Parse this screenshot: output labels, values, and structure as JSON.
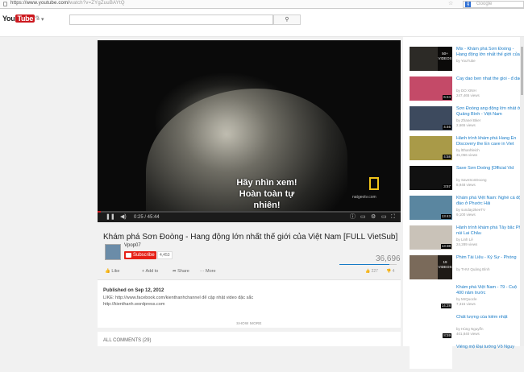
{
  "browser": {
    "url_prefix": "https://www.youtube.com/",
    "url_rest": "watch?v=ZYgZuuBAYtQ",
    "search_placeholder": "Google",
    "search_engine_icon": "g-icon"
  },
  "masthead": {
    "logo_you": "You",
    "logo_tube": "Tube",
    "logo_region": "VN",
    "guide_icon": "menu-icon",
    "search_icon": "magnifier-icon"
  },
  "player": {
    "subtitle_line1": "Hãy nhìn xem!",
    "subtitle_line2": "Hoàn toàn tự nhiên!",
    "watermark": "natgeotv.com",
    "time": "0:25 / 45:44",
    "progress_fraction": 0.01
  },
  "video": {
    "title": "Khám phá Sơn Đoòng - Hang động lớn nhất thế giới của Việt Nam [FULL VietSub]",
    "channel": "Vpop07",
    "subscribe_label": "Subscribe",
    "subscriber_count": "4,453",
    "views": "36,696",
    "like_fraction": 0.87,
    "actions": {
      "like": "Like",
      "add": "Add to",
      "share": "Share",
      "more": "More"
    },
    "likes": "227",
    "dislikes": "4"
  },
  "description": {
    "published": "Published on Sep 12, 2012",
    "line1": "LIKE: http://www.facebook.com/kienthanhchannel để cập nhật video đặc sắc",
    "line2": "http://kienthanh.wordpress.com",
    "show_more": "SHOW MORE"
  },
  "comments": {
    "label": "ALL COMMENTS (29)"
  },
  "sidebar": [
    {
      "title": "Mix - Khám phá Sơn Đoòng - Hang động lớn nhất thế giới của Việt",
      "channel": "by YouTube",
      "views": "",
      "duration": "",
      "mix_count": "50+",
      "mix_label": "VIDEOS",
      "color": "#2c2a26"
    },
    {
      "title": "Cay dao ben nhat the gioi - đ dao",
      "channel": "by DO XINH",
      "views": "247,465 views",
      "duration": "6:24",
      "color": "#c44a68"
    },
    {
      "title": "Sơn Đoòng ang động lớn nhất ở Quảng Bình - Việt Nam",
      "channel": "by Zhanel Bker",
      "views": "2,665 views",
      "duration": "4:46",
      "color": "#3d4a5e"
    },
    {
      "title": "Hành trình khám phá Hang Én Discovery the En cave in Viet",
      "channel": "by ltthanhleich",
      "views": "31,056 views",
      "duration": "4:58",
      "color": "#a99a48"
    },
    {
      "title": "Save Sơn Doòng [Official Vid",
      "channel": "by SaveSonDoong",
      "views": "8,948 views",
      "duration": "3:57",
      "color": "#111111"
    },
    {
      "title": "Khám phá Việt Nam: Nghề cá độc đáo ở Phước Hải",
      "channel": "by sunday2keeTV",
      "views": "9,100 views",
      "duration": "13:43",
      "color": "#5a86a0"
    },
    {
      "title": "Hành trình khám phá Tây bắc Phố núi Lai Châu",
      "channel": "by Linh Lê",
      "views": "24,289 views",
      "duration": "13:38",
      "color": "#c9c2b8"
    },
    {
      "title": "Phim Tài Liệu - Ký Sự - Phóng",
      "channel": "by THVI Quảng Bình",
      "views": "",
      "duration": "",
      "mix_count": "19",
      "mix_label": "VIDEOS",
      "color": "#7a6a5a"
    },
    {
      "title": "Khám phá Việt Nam - 79 - Cuộ 400 năm trước",
      "channel": "by MrQuocle",
      "views": "7,315 views",
      "duration": "14:28",
      "color": "#ffffff"
    },
    {
      "title": "Chất lượng của kiếm nhật",
      "channel": "by Hùng Nguyễn",
      "views": "401,840 views",
      "duration": "8:59",
      "color": "#ffffff"
    },
    {
      "title": "Viếng mộ Đại tướng Võ Nguy",
      "channel": "",
      "views": "",
      "duration": "",
      "color": "#ffffff"
    }
  ]
}
